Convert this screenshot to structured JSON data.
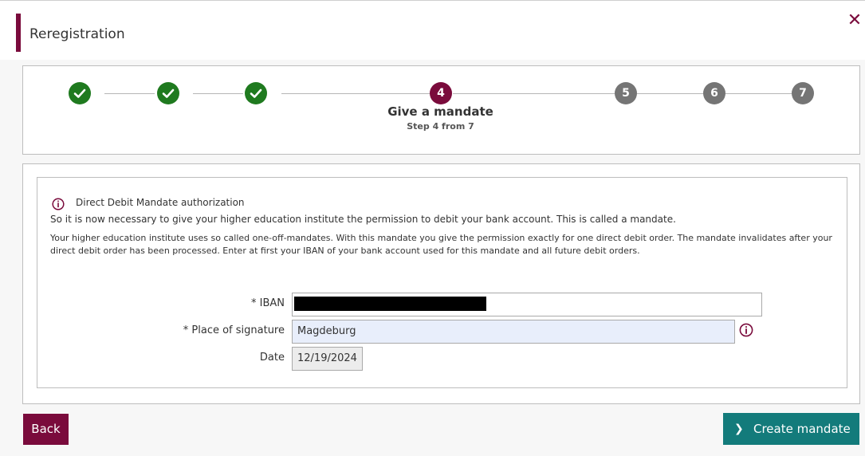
{
  "dialog": {
    "title": "Reregistration",
    "close_icon": "close-icon",
    "accent_color": "#7a0b3c"
  },
  "stepper": {
    "current_step_title": "Give a mandate",
    "current_step_sub": "Step 4 from 7",
    "steps": [
      {
        "number": "1",
        "state": "done"
      },
      {
        "number": "2",
        "state": "done"
      },
      {
        "number": "3",
        "state": "done"
      },
      {
        "number": "4",
        "state": "active"
      },
      {
        "number": "5",
        "state": "todo"
      },
      {
        "number": "6",
        "state": "todo"
      },
      {
        "number": "7",
        "state": "todo"
      }
    ],
    "colors": {
      "done": "#1f7a1f",
      "active": "#7a0b3c",
      "todo": "#757575"
    }
  },
  "info": {
    "title": "Direct Debit Mandate authorization",
    "line1": "So it is now necessary to give your higher education institute the permission to debit your bank account. This is called a mandate.",
    "line2": "Your higher education institute uses so called one-off-mandates. With this mandate you give the permission exactly for one direct debit order. The mandate invalidates after your direct debit order has been processed. Enter at first your IBAN of your bank account used for this mandate and all future debit orders."
  },
  "form": {
    "iban_label": "* IBAN",
    "iban_value": "",
    "place_label": "* Place of signature",
    "place_value": "Magdeburg",
    "date_label": "Date",
    "date_value": "12/19/2024"
  },
  "buttons": {
    "back_label": "Back",
    "create_label": "Create mandate",
    "back_color": "#7a0b3c",
    "create_color": "#137b7b"
  }
}
